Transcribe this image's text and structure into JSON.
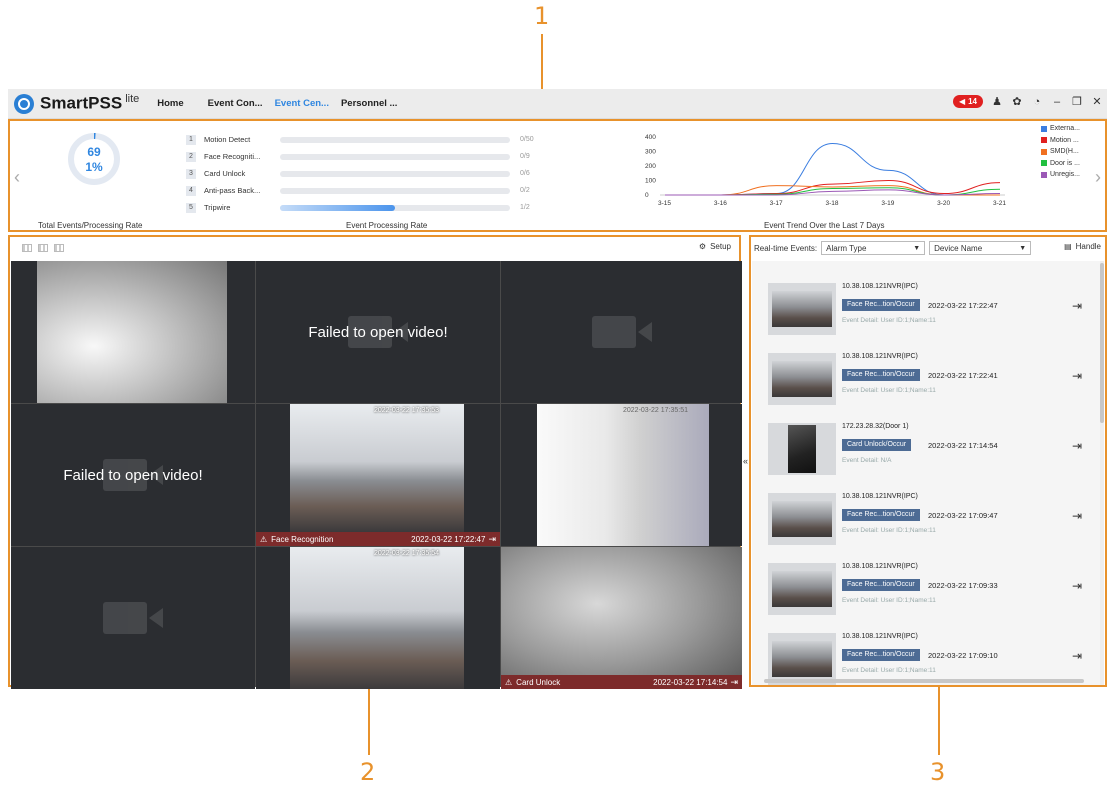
{
  "callouts": [
    "1",
    "2",
    "3"
  ],
  "app": {
    "logo": "SmartPSS",
    "logo_sup": "lite",
    "tabs": [
      {
        "label": "Home"
      },
      {
        "label": "Event Con..."
      },
      {
        "label": "Event Cen..."
      },
      {
        "label": "Personnel ..."
      }
    ],
    "active_tab": "Event Cen...",
    "alarm_count": "14"
  },
  "overview": {
    "rate_count": "69",
    "rate_percent": "1%",
    "rate_label": "Total Events/Processing Rate",
    "processing_title": "Event Processing Rate",
    "processing_items": [
      {
        "rank": "1",
        "name": "Motion Detect",
        "count": "0/50",
        "fraction": 0
      },
      {
        "rank": "2",
        "name": "Face Recogniti...",
        "count": "0/9",
        "fraction": 0
      },
      {
        "rank": "3",
        "name": "Card Unlock",
        "count": "0/6",
        "fraction": 0
      },
      {
        "rank": "4",
        "name": "Anti-pass Back...",
        "count": "0/2",
        "fraction": 0
      },
      {
        "rank": "5",
        "name": "Tripwire",
        "count": "1/2",
        "fraction": 0.5
      }
    ],
    "trend_title": "Event Trend Over the Last 7 Days"
  },
  "chart_data": {
    "type": "line",
    "title": "Event Trend Over the Last 7 Days",
    "categories": [
      "3-15",
      "3-16",
      "3-17",
      "3-18",
      "3-19",
      "3-20",
      "3-21"
    ],
    "y_ticks": [
      "400",
      "300",
      "200",
      "100",
      "0"
    ],
    "ylim": [
      0,
      400
    ],
    "legend_position": "right",
    "series": [
      {
        "name": "Externa...",
        "color": "#3a7de0",
        "values": [
          0,
          0,
          10,
          355,
          170,
          0,
          0
        ]
      },
      {
        "name": "Motion ...",
        "color": "#e02020",
        "values": [
          0,
          0,
          10,
          75,
          100,
          10,
          85
        ]
      },
      {
        "name": "SMD(H...",
        "color": "#f07020",
        "values": [
          0,
          0,
          65,
          55,
          65,
          0,
          0
        ]
      },
      {
        "name": "Door is ...",
        "color": "#22c040",
        "values": [
          0,
          0,
          5,
          45,
          50,
          0,
          40
        ]
      },
      {
        "name": "Unregis...",
        "color": "#9b59b6",
        "values": [
          0,
          0,
          0,
          25,
          35,
          0,
          10
        ]
      }
    ]
  },
  "video": {
    "setup_label": "Setup",
    "fail_text": "Failed to open video!",
    "cells": [
      {
        "kind": "image",
        "scene": "ceiling"
      },
      {
        "kind": "fail"
      },
      {
        "kind": "empty"
      },
      {
        "kind": "fail"
      },
      {
        "kind": "image",
        "scene": "office",
        "ts": "2022-03-22 17:35:53",
        "event": "Face Recognition",
        "event_time": "2022-03-22 17:22:47"
      },
      {
        "kind": "image",
        "scene": "glass",
        "ts": "2022-03-22 17:35:51"
      },
      {
        "kind": "empty"
      },
      {
        "kind": "image",
        "scene": "office",
        "ts": "2022-03-22 17:35:54"
      },
      {
        "kind": "image",
        "scene": "gray",
        "event": "Card Unlock",
        "event_time": "2022-03-22 17:14:54"
      }
    ]
  },
  "realtime": {
    "label": "Real-time Events:",
    "alarm_type": "Alarm Type",
    "device_name": "Device Name",
    "handle_label": "Handle",
    "events": [
      {
        "source": "10.38.108.121NVR(IPC)",
        "tag": "Face Rec...tion/Occur",
        "time": "2022-03-22 17:22:47",
        "detail": "Event Detail: User ID:1;Name:11",
        "thumb": "office"
      },
      {
        "source": "10.38.108.121NVR(IPC)",
        "tag": "Face Rec...tion/Occur",
        "time": "2022-03-22 17:22:41",
        "detail": "Event Detail: User ID:1;Name:11",
        "thumb": "office"
      },
      {
        "source": "172.23.28.32(Door 1)",
        "tag": "Card Unlock/Occur",
        "time": "2022-03-22 17:14:54",
        "detail": "Event Detail: N/A",
        "thumb": "door"
      },
      {
        "source": "10.38.108.121NVR(IPC)",
        "tag": "Face Rec...tion/Occur",
        "time": "2022-03-22 17:09:47",
        "detail": "Event Detail: User ID:1;Name:11",
        "thumb": "office"
      },
      {
        "source": "10.38.108.121NVR(IPC)",
        "tag": "Face Rec...tion/Occur",
        "time": "2022-03-22 17:09:33",
        "detail": "Event Detail: User ID:1;Name:11",
        "thumb": "office"
      },
      {
        "source": "10.38.108.121NVR(IPC)",
        "tag": "Face Rec...tion/Occur",
        "time": "2022-03-22 17:09:10",
        "detail": "Event Detail: User ID:1;Name:11",
        "thumb": "office"
      }
    ]
  }
}
